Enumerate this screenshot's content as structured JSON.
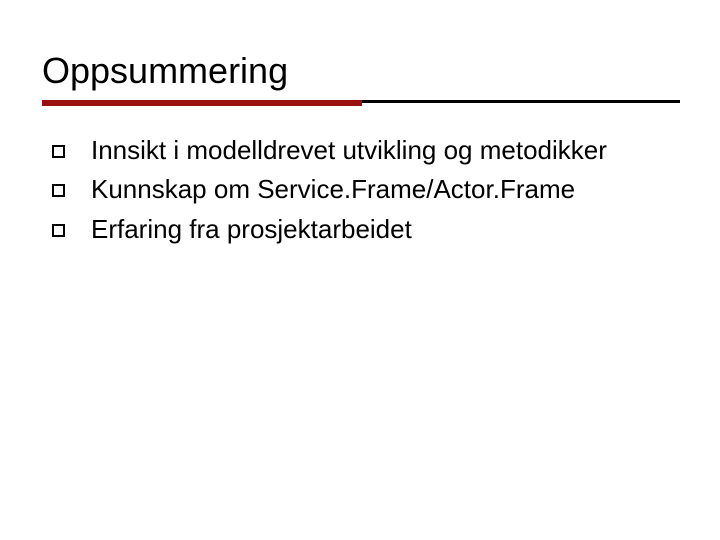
{
  "slide": {
    "title": "Oppsummering",
    "accent_color": "#9a0f0f",
    "bullets": [
      {
        "text": "Innsikt i modelldrevet utvikling og metodikker"
      },
      {
        "text": "Kunnskap om Service.Frame/Actor.Frame"
      },
      {
        "text": "Erfaring fra prosjektarbeidet"
      }
    ]
  }
}
